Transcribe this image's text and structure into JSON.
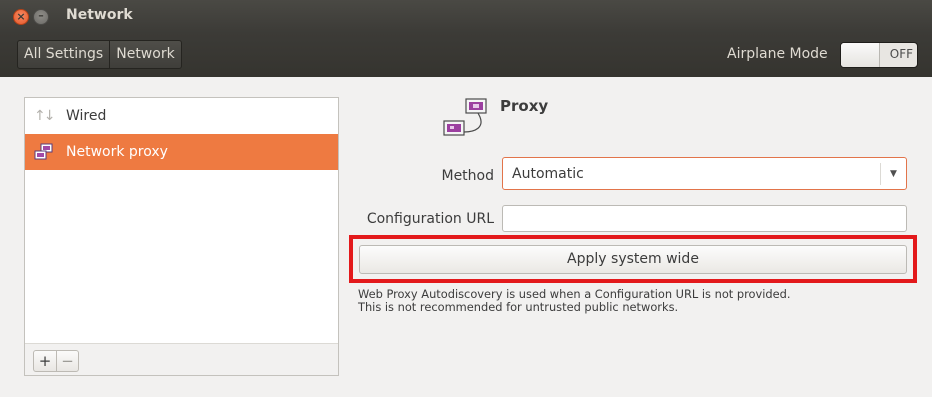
{
  "window": {
    "title": "Network",
    "close_glyph": "×",
    "minimize_glyph": "–"
  },
  "toolbar": {
    "breadcrumbs": [
      "All Settings",
      "Network"
    ],
    "airplane_label": "Airplane Mode",
    "airplane_state": "OFF"
  },
  "sidebar": {
    "items": [
      {
        "label": "Wired",
        "icon": "network-wired-arrows-icon",
        "selected": false
      },
      {
        "label": "Network proxy",
        "icon": "network-proxy-icon",
        "selected": true
      }
    ],
    "add_label": "+",
    "remove_label": "−"
  },
  "proxy": {
    "title": "Proxy",
    "method_label": "Method",
    "method_value": "Automatic",
    "config_url_label": "Configuration URL",
    "config_url_value": "",
    "apply_label": "Apply system wide",
    "note_line1": "Web Proxy Autodiscovery is used when a Configuration URL is not provided.",
    "note_line2": "This is not recommended for untrusted public networks."
  },
  "colors": {
    "selection": "#ee7a41",
    "highlight_outline": "#e3191b",
    "titlebar": "#3c3b37"
  }
}
